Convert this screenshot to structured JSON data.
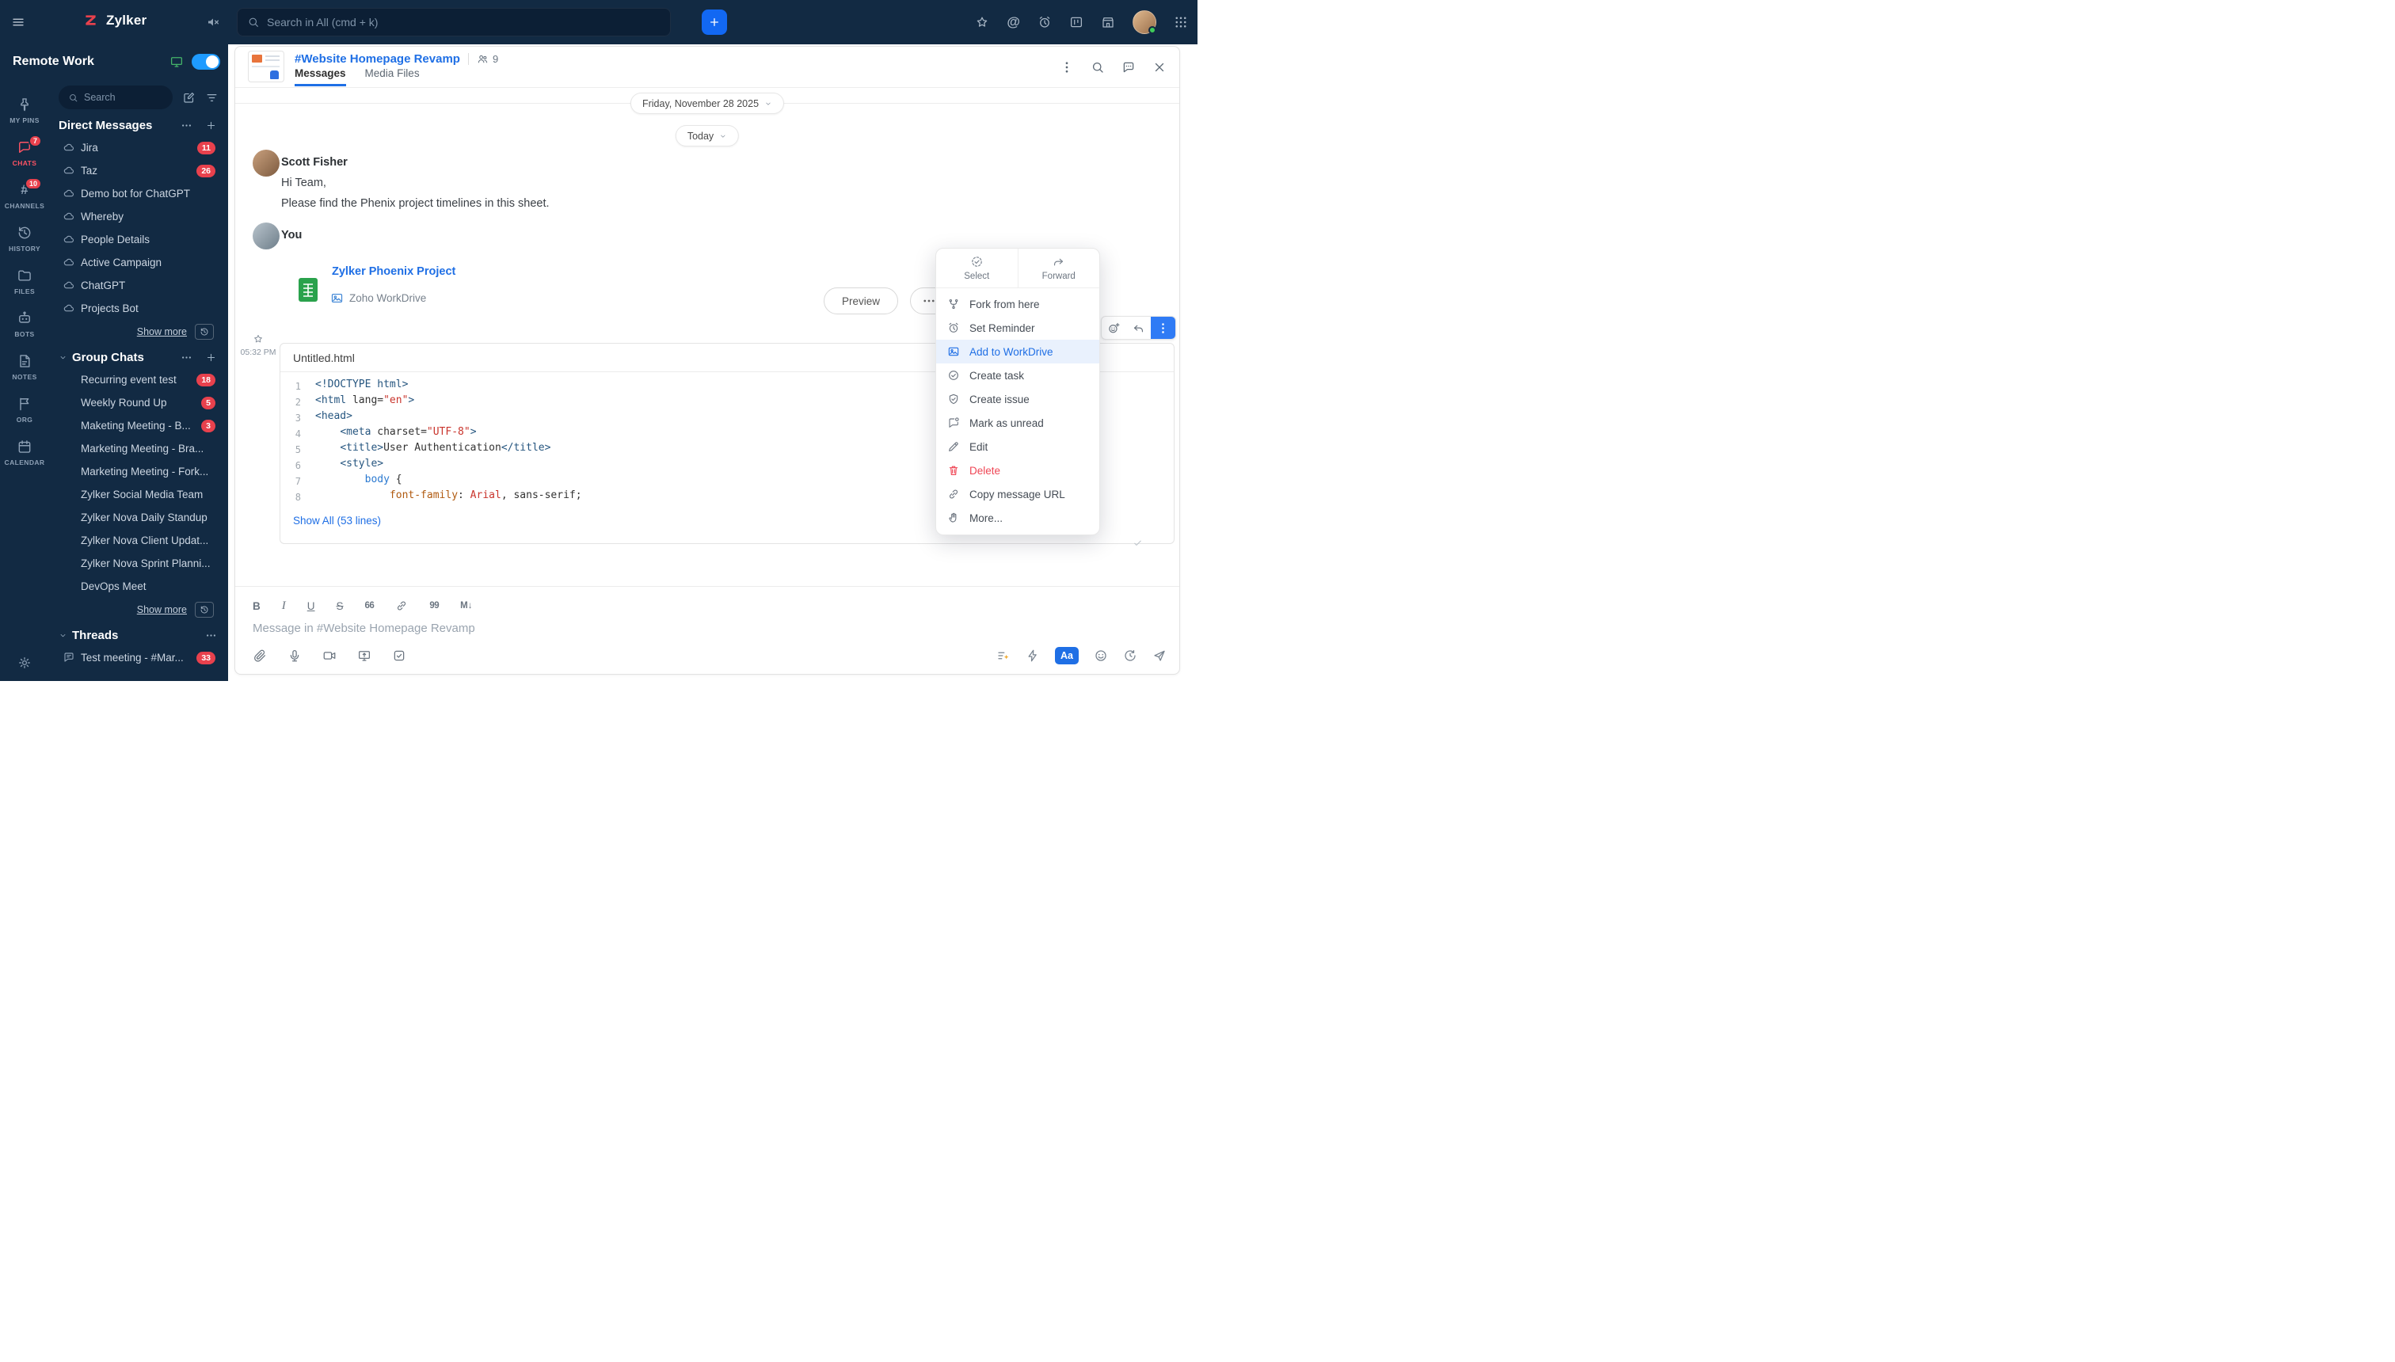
{
  "topbar": {
    "brand": "Zylker",
    "search_placeholder": "Search in All (cmd + k)"
  },
  "sidebar": {
    "workspace": "Remote Work",
    "search_placeholder": "Search",
    "rail": [
      {
        "label": "MY PINS",
        "icon": "pin"
      },
      {
        "label": "CHATS",
        "icon": "chat",
        "badge": "7",
        "active": true
      },
      {
        "label": "CHANNELS",
        "icon": "hash",
        "badge": "10"
      },
      {
        "label": "HISTORY",
        "icon": "history"
      },
      {
        "label": "FILES",
        "icon": "folder"
      },
      {
        "label": "BOTS",
        "icon": "bot"
      },
      {
        "label": "NOTES",
        "icon": "note"
      },
      {
        "label": "ORG",
        "icon": "org"
      },
      {
        "label": "CALENDAR",
        "icon": "calendar"
      }
    ],
    "sections": [
      {
        "id": "direct-messages",
        "title": "Direct Messages",
        "caret": false,
        "actions": [
          "more",
          "add"
        ],
        "items": [
          {
            "name": "Jira",
            "badge": "11",
            "icon": "cloud"
          },
          {
            "name": "Taz",
            "badge": "26",
            "icon": "cloud"
          },
          {
            "name": "Demo bot for ChatGPT",
            "icon": "cloud"
          },
          {
            "name": "Whereby",
            "icon": "cloud"
          },
          {
            "name": "People Details",
            "icon": "cloud"
          },
          {
            "name": "Active Campaign",
            "icon": "cloud"
          },
          {
            "name": "ChatGPT",
            "icon": "cloud"
          },
          {
            "name": "Projects Bot",
            "icon": "cloud"
          }
        ],
        "show_more": "Show more"
      },
      {
        "id": "group-chats",
        "title": "Group Chats",
        "caret": true,
        "actions": [
          "more",
          "add"
        ],
        "items": [
          {
            "name": "Recurring event test",
            "badge": "18"
          },
          {
            "name": "Weekly Round Up",
            "badge": "5"
          },
          {
            "name": "Maketing Meeting - B...",
            "badge": "3"
          },
          {
            "name": "Marketing Meeting - Bra..."
          },
          {
            "name": "Marketing Meeting - Fork..."
          },
          {
            "name": "Zylker Social Media Team"
          },
          {
            "name": "Zylker Nova Daily Standup"
          },
          {
            "name": "Zylker Nova Client Updat..."
          },
          {
            "name": "Zylker Nova Sprint Planni..."
          },
          {
            "name": "DevOps Meet"
          }
        ],
        "show_more": "Show more"
      },
      {
        "id": "threads",
        "title": "Threads",
        "caret": true,
        "actions": [
          "more"
        ],
        "items": [
          {
            "name": "Test meeting - #Mar...",
            "badge": "33",
            "icon": "thread"
          }
        ]
      }
    ]
  },
  "chat": {
    "title": "#Website Homepage Revamp",
    "members": "9",
    "tabs": [
      {
        "label": "Messages",
        "active": true
      },
      {
        "label": "Media Files",
        "active": false
      }
    ],
    "date_divider": "Friday, November 28 2025",
    "today": "Today",
    "message1": {
      "sender": "Scott Fisher",
      "line1": "Hi Team,",
      "line2": "Please find the Phenix project timelines in this sheet."
    },
    "message2": {
      "sender": "You",
      "attachment": {
        "title": "Zylker Phoenix Project",
        "source": "Zoho WorkDrive",
        "preview": "Preview"
      }
    },
    "snippet": {
      "time": "05:32 PM",
      "filename": "Untitled.html",
      "show_all": "Show All (53 lines)",
      "lines": [
        {
          "n": "1",
          "tokens": [
            {
              "c": "tag",
              "t": "<!DOCTYPE html>"
            }
          ]
        },
        {
          "n": "2",
          "tokens": [
            {
              "c": "tag",
              "t": "<html"
            },
            {
              "c": "plain",
              "t": " lang="
            },
            {
              "c": "str",
              "t": "\"en\""
            },
            {
              "c": "tag",
              "t": ">"
            }
          ]
        },
        {
          "n": "3",
          "tokens": [
            {
              "c": "tag",
              "t": "<head>"
            }
          ]
        },
        {
          "n": "4",
          "tokens": [
            {
              "c": "plain",
              "t": "    "
            },
            {
              "c": "tag",
              "t": "<meta"
            },
            {
              "c": "plain",
              "t": " charset="
            },
            {
              "c": "str",
              "t": "\"UTF-8\""
            },
            {
              "c": "tag",
              "t": ">"
            }
          ]
        },
        {
          "n": "5",
          "tokens": [
            {
              "c": "plain",
              "t": "    "
            },
            {
              "c": "tag",
              "t": "<title>"
            },
            {
              "c": "plain",
              "t": "User Authentication"
            },
            {
              "c": "tag",
              "t": "</title>"
            }
          ]
        },
        {
          "n": "6",
          "tokens": [
            {
              "c": "plain",
              "t": "    "
            },
            {
              "c": "tag",
              "t": "<style>"
            }
          ]
        },
        {
          "n": "7",
          "tokens": [
            {
              "c": "plain",
              "t": "        "
            },
            {
              "c": "sel",
              "t": "body"
            },
            {
              "c": "plain",
              "t": " {"
            }
          ]
        },
        {
          "n": "8",
          "tokens": [
            {
              "c": "plain",
              "t": "            "
            },
            {
              "c": "prop",
              "t": "font-family"
            },
            {
              "c": "plain",
              "t": ": "
            },
            {
              "c": "str",
              "t": "Arial"
            },
            {
              "c": "plain",
              "t": ", sans-serif;"
            }
          ]
        }
      ]
    }
  },
  "context_menu": {
    "top": [
      {
        "label": "Select",
        "icon": "select"
      },
      {
        "label": "Forward",
        "icon": "forward"
      }
    ],
    "items": [
      {
        "label": "Fork from here",
        "icon": "fork"
      },
      {
        "label": "Set Reminder",
        "icon": "alarm"
      },
      {
        "label": "Add to WorkDrive",
        "icon": "workdrive",
        "state": "highlighted"
      },
      {
        "label": "Create task",
        "icon": "task"
      },
      {
        "label": "Create issue",
        "icon": "issue"
      },
      {
        "label": "Mark as unread",
        "icon": "unread"
      },
      {
        "label": "Edit",
        "icon": "pencil"
      },
      {
        "label": "Delete",
        "icon": "trash",
        "state": "danger"
      },
      {
        "label": "Copy message URL",
        "icon": "link"
      },
      {
        "label": "More...",
        "icon": "hand"
      }
    ]
  },
  "composer": {
    "placeholder": "Message in #Website Homepage Revamp",
    "format_labels": {
      "bold": "B",
      "italic": "I",
      "underline": "U",
      "strike": "S",
      "quote_open": "66",
      "quote_close": "99",
      "markdown": "M↓"
    },
    "aa_label": "Aa"
  },
  "colors": {
    "accent_blue": "#1f6fe5",
    "badge_red": "#e8414d",
    "navy": "#122a43",
    "highlight_row": "#e9f1fd"
  }
}
